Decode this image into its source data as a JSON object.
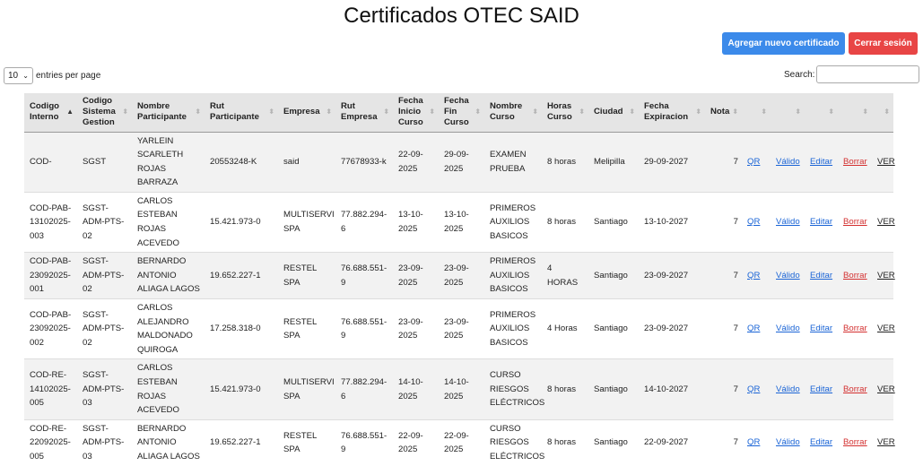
{
  "header": {
    "title": "Certificados OTEC SAID",
    "add_button": "Agregar nuevo certificado",
    "logout_button": "Cerrar sesión"
  },
  "controls": {
    "entries_value": "10",
    "entries_label": "entries per page",
    "search_label": "Search:",
    "search_value": ""
  },
  "table": {
    "columns": [
      "Codigo Interno",
      "Codigo Sistema Gestion",
      "Nombre Participante",
      "Rut Participante",
      "Empresa",
      "Rut Empresa",
      "Fecha Inicio Curso",
      "Fecha Fin Curso",
      "Nombre Curso",
      "Horas Curso",
      "Ciudad",
      "Fecha Expiracion",
      "Nota",
      "",
      "",
      "",
      "",
      ""
    ],
    "sort_icons": {
      "active": "▲",
      "inactive": "⬍"
    },
    "rows": [
      {
        "codigo_interno": "COD-",
        "codigo_sistema": "SGST",
        "nombre": "YARLEIN SCARLETH ROJAS BARRAZA",
        "rut_participante": "20553248-K",
        "empresa": "said",
        "rut_empresa": "77678933-k",
        "fecha_inicio": "22-09-2025",
        "fecha_fin": "29-09-2025",
        "curso": "EXAMEN PRUEBA",
        "horas": "8 horas",
        "ciudad": "Melipilla",
        "expiracion": "29-09-2027",
        "nota": "7",
        "qr": "QR",
        "valido": "Válido",
        "editar": "Editar",
        "borrar": "Borrar",
        "ver": "VER"
      },
      {
        "codigo_interno": "COD-PAB-13102025-003",
        "codigo_sistema": "SGST-ADM-PTS-02",
        "nombre": "CARLOS ESTEBAN ROJAS ACEVEDO",
        "rut_participante": "15.421.973-0",
        "empresa": "MULTISERVI SPA",
        "rut_empresa": "77.882.294-6",
        "fecha_inicio": "13-10-2025",
        "fecha_fin": "13-10-2025",
        "curso": "PRIMEROS AUXILIOS BASICOS",
        "horas": "8 horas",
        "ciudad": "Santiago",
        "expiracion": "13-10-2027",
        "nota": "7",
        "qr": "QR",
        "valido": "Válido",
        "editar": "Editar",
        "borrar": "Borrar",
        "ver": "VER"
      },
      {
        "codigo_interno": "COD-PAB-23092025-001",
        "codigo_sistema": "SGST-ADM-PTS-02",
        "nombre": "BERNARDO ANTONIO ALIAGA LAGOS",
        "rut_participante": "19.652.227-1",
        "empresa": "RESTEL SPA",
        "rut_empresa": "76.688.551-9",
        "fecha_inicio": "23-09-2025",
        "fecha_fin": "23-09-2025",
        "curso": "PRIMEROS AUXILIOS BASICOS",
        "horas": "4 HORAS",
        "ciudad": "Santiago",
        "expiracion": "23-09-2027",
        "nota": "7",
        "qr": "QR",
        "valido": "Válido",
        "editar": "Editar",
        "borrar": "Borrar",
        "ver": "VER"
      },
      {
        "codigo_interno": "COD-PAB-23092025-002",
        "codigo_sistema": "SGST-ADM-PTS-02",
        "nombre": "CARLOS ALEJANDRO MALDONADO QUIROGA",
        "rut_participante": "17.258.318-0",
        "empresa": "RESTEL SPA",
        "rut_empresa": "76.688.551-9",
        "fecha_inicio": "23-09-2025",
        "fecha_fin": "23-09-2025",
        "curso": "PRIMEROS AUXILIOS BASICOS",
        "horas": "4 Horas",
        "ciudad": "Santiago",
        "expiracion": "23-09-2027",
        "nota": "7",
        "qr": "QR",
        "valido": "Válido",
        "editar": "Editar",
        "borrar": "Borrar",
        "ver": "VER"
      },
      {
        "codigo_interno": "COD-RE-14102025-005",
        "codigo_sistema": "SGST-ADM-PTS-03",
        "nombre": "CARLOS ESTEBAN ROJAS ACEVEDO",
        "rut_participante": "15.421.973-0",
        "empresa": "MULTISERVI SPA",
        "rut_empresa": "77.882.294-6",
        "fecha_inicio": "14-10-2025",
        "fecha_fin": "14-10-2025",
        "curso": "CURSO RIESGOS ELÉCTRICOS",
        "horas": "8 horas",
        "ciudad": "Santiago",
        "expiracion": "14-10-2027",
        "nota": "7",
        "qr": "QR",
        "valido": "Válido",
        "editar": "Editar",
        "borrar": "Borrar",
        "ver": "VER"
      },
      {
        "codigo_interno": "COD-RE-22092025-005",
        "codigo_sistema": "SGST-ADM-PTS-03",
        "nombre": "BERNARDO ANTONIO ALIAGA LAGOS",
        "rut_participante": "19.652.227-1",
        "empresa": "RESTEL SPA",
        "rut_empresa": "76.688.551-9",
        "fecha_inicio": "22-09-2025",
        "fecha_fin": "22-09-2025",
        "curso": "CURSO RIESGOS ELÉCTRICOS",
        "horas": "8 horas",
        "ciudad": "Santiago",
        "expiracion": "22-09-2027",
        "nota": "7",
        "qr": "QR",
        "valido": "Válido",
        "editar": "Editar",
        "borrar": "Borrar",
        "ver": "VER"
      }
    ]
  }
}
